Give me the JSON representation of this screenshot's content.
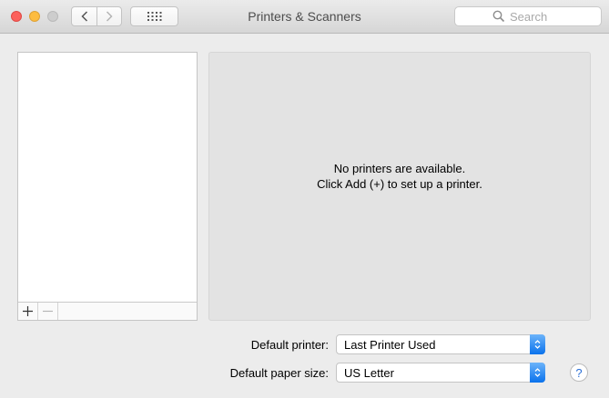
{
  "window": {
    "title": "Printers & Scanners",
    "search_placeholder": "Search"
  },
  "detail": {
    "empty_line1": "No printers are available.",
    "empty_line2": "Click Add (+) to set up a printer."
  },
  "list_toolbar": {
    "add_icon": "plus-icon",
    "remove_icon": "minus-icon"
  },
  "settings": {
    "default_printer_label": "Default printer:",
    "default_printer_value": "Last Printer Used",
    "paper_size_label": "Default paper size:",
    "paper_size_value": "US Letter"
  },
  "help": {
    "label": "?"
  },
  "colors": {
    "accent": "#0a72ec",
    "close": "#fc605b",
    "minimize": "#fdbc40"
  }
}
